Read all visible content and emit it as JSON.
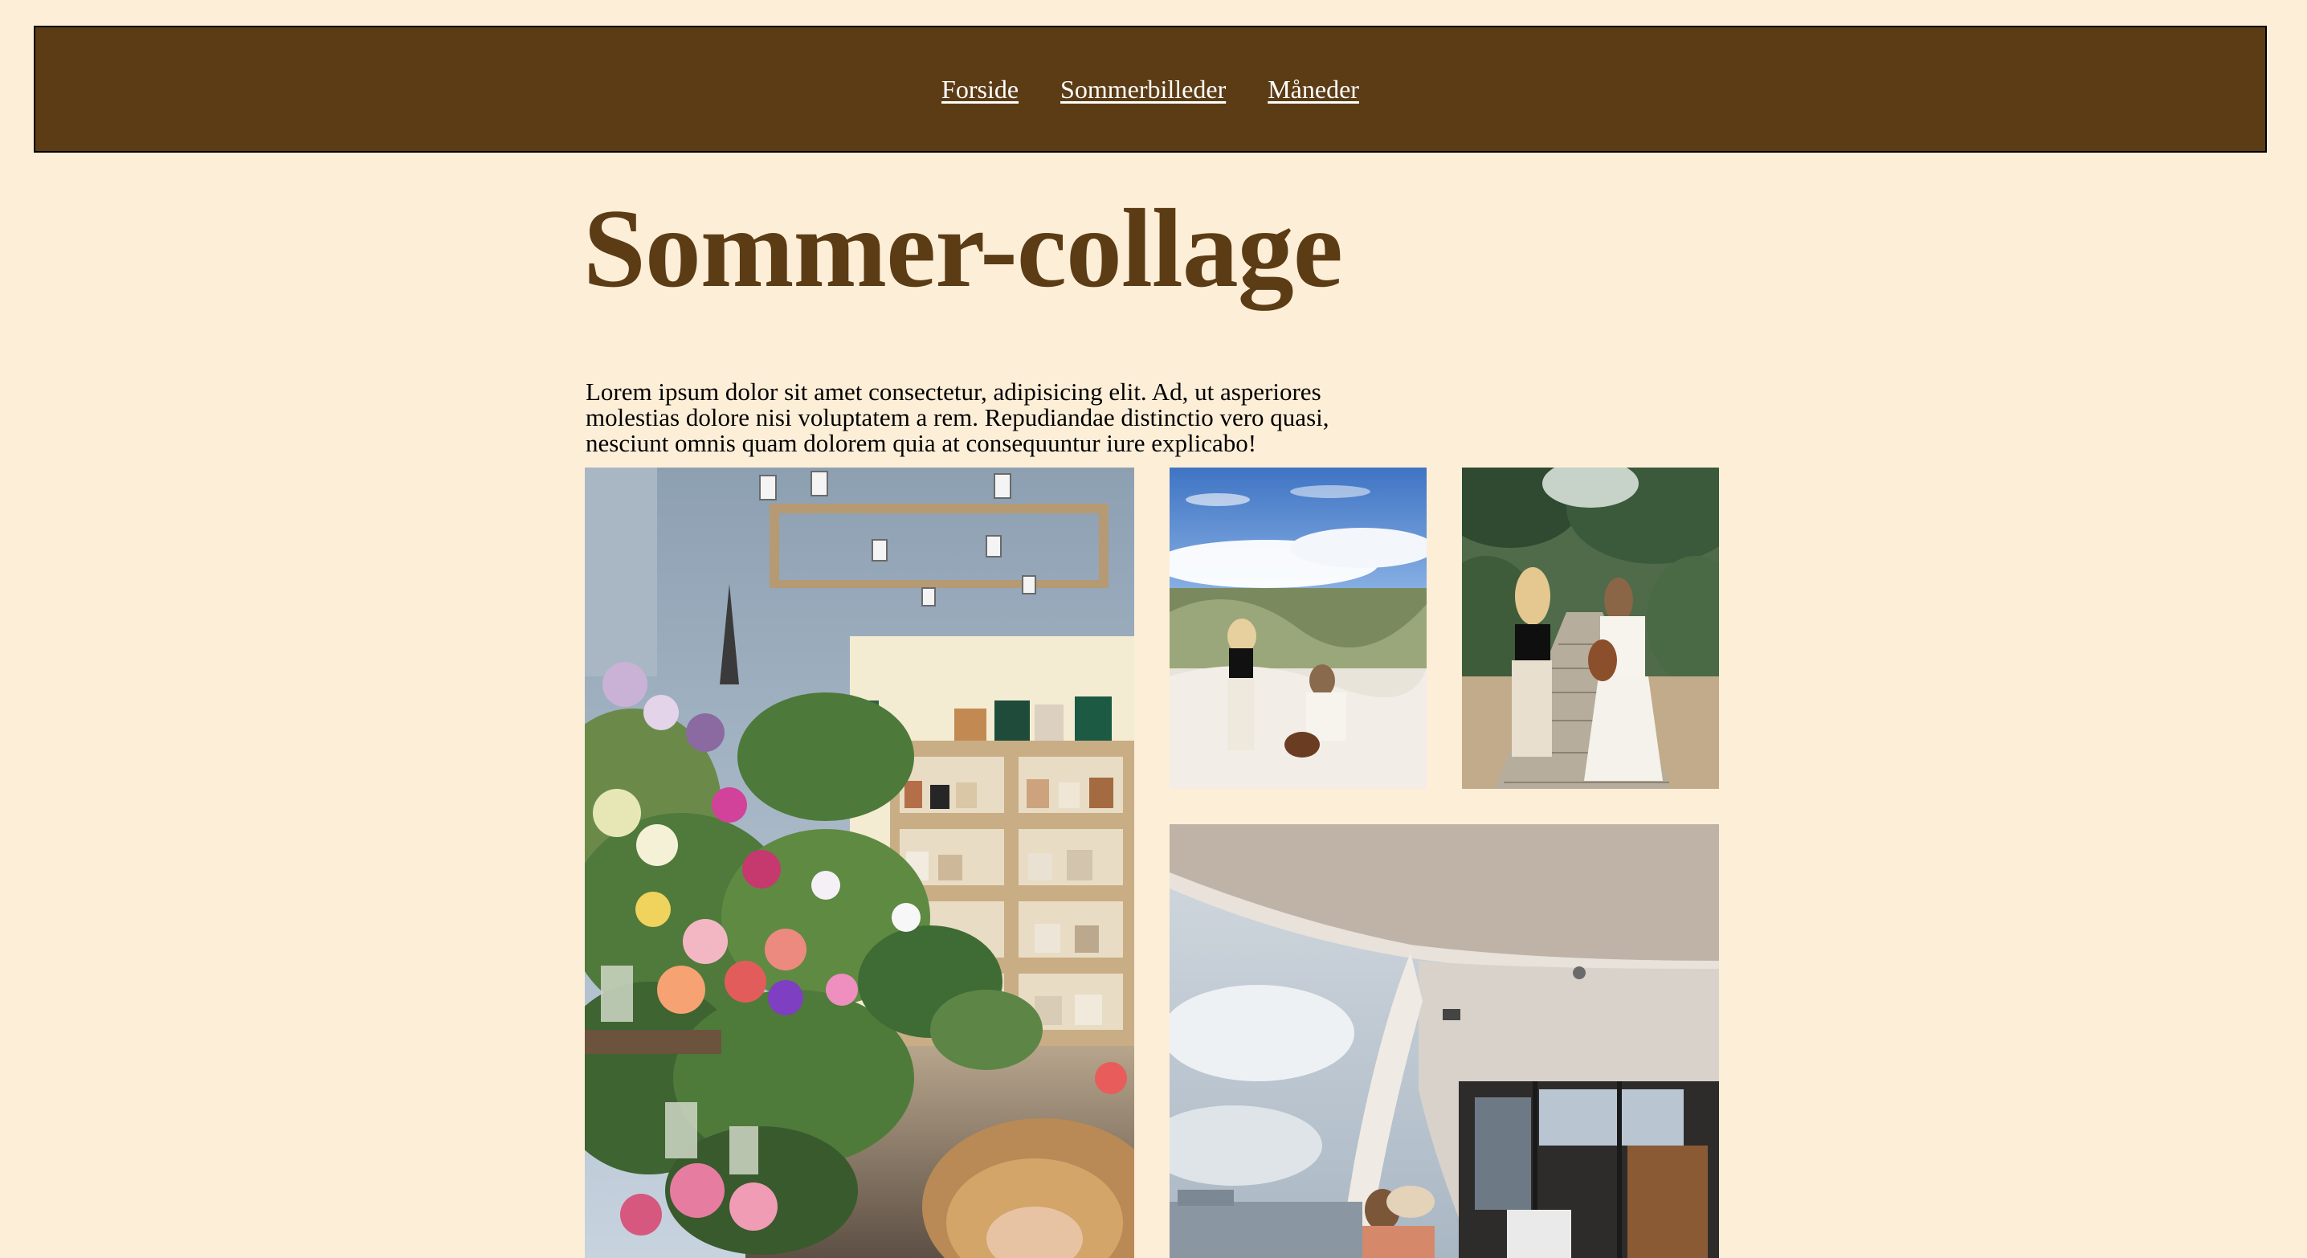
{
  "nav": {
    "items": [
      {
        "label": "Forside"
      },
      {
        "label": "Sommerbilleder"
      },
      {
        "label": "Måneder"
      }
    ]
  },
  "page": {
    "title": "Sommer-collage",
    "intro": "Lorem ipsum dolor sit amet consectetur, adipisicing elit. Ad, ut asperiores molestias dolore nisi voluptatem a rem. Repudiandae distinctio vero quasi, nesciunt omnis quam dolorem quia at consequuntur iure explicabo!"
  },
  "colors": {
    "background": "#fdeed8",
    "nav_bg": "#5c3c15",
    "title": "#5c3c15"
  }
}
